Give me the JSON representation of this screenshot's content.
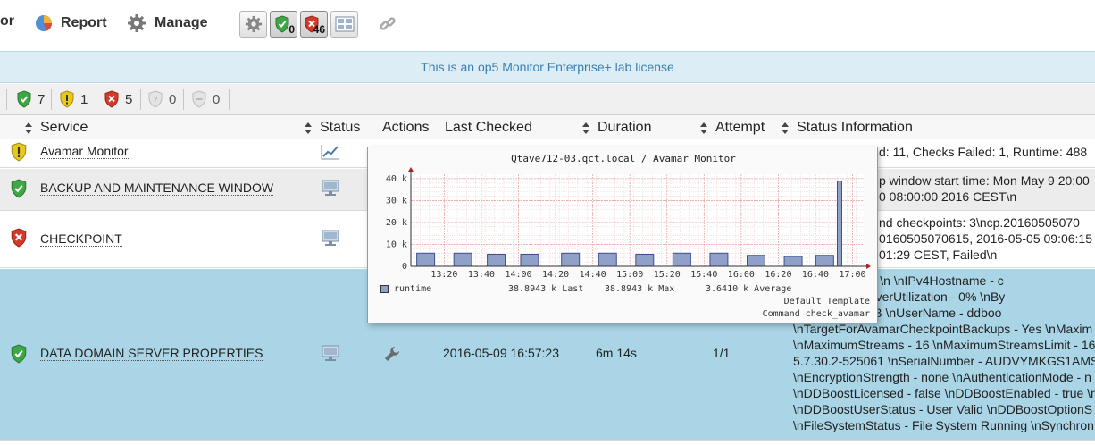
{
  "nav": {
    "partial_label": "or",
    "report_label": "Report",
    "manage_label": "Manage"
  },
  "toolbar": {
    "ok_count": "0",
    "critical_count": "46"
  },
  "banner": {
    "text": "This is an op5 Monitor Enterprise+ lab license"
  },
  "summary": {
    "ok": "7",
    "warning": "1",
    "critical": "5",
    "unknown": "0",
    "pending": "0"
  },
  "columns": {
    "service": "Service",
    "status": "Status",
    "actions": "Actions",
    "last_checked": "Last Checked",
    "duration": "Duration",
    "attempt": "Attempt",
    "status_info": "Status Information"
  },
  "rows": [
    {
      "service": "Avamar Monitor",
      "state": "warning",
      "info": [
        "d: 11, Checks Failed: 1, Runtime: 488"
      ]
    },
    {
      "service": "BACKUP AND MAINTENANCE WINDOW",
      "state": "ok",
      "info": [
        "p window start time: Mon May 9 20:00",
        "0 08:00:00 2016 CEST\\n"
      ]
    },
    {
      "service": "CHECKPOINT",
      "state": "critical",
      "info": [
        "nd checkpoints: 3\\ncp.20160505070",
        "0160505070615, 2016-05-05 09:06:15",
        "01:29 CEST, Failed\\n"
      ]
    },
    {
      "service": "DATA DOMAIN SERVER PROPERTIES",
      "state": "ok",
      "last_checked": "2016-05-09 16:57:23",
      "duration": "6m 14s",
      "attempt": "1/1",
      "info": [
        "ore information \\n \\nIPv4Hostname - c",
        "- 0.0 GiB \\nServerUtilization - 0% \\nBy",
        "nUsed - 0.0 GiB \\nUserName - ddboo",
        "\\nTargetForAvamarCheckpointBackups - Yes \\nMaxim",
        "\\nMaximumStreams - 16 \\nMaximumStreamsLimit - 16",
        "5.7.30.2-525061 \\nSerialNumber - AUDVYMKGS1AMS",
        "\\nEncryptionStrength - none \\nAuthenticationMode - n",
        "\\nDDBoostLicensed - false \\nDDBoostEnabled - true \\n",
        "\\nDDBoostUserStatus - User Valid \\nDDBoostOptionS",
        "\\nFileSystemStatus - File System Running \\nSynchron"
      ]
    }
  ],
  "popup": {
    "title": "Qtave712-03.qct.local / Avamar Monitor",
    "legend_label": "runtime",
    "last": "38.8943 k Last",
    "max": "38.8943 k Max",
    "average": "3.6410 k Average",
    "template": "Default Template",
    "command": "Command check_avamar"
  },
  "chart_data": {
    "type": "bar",
    "title": "Qtave712-03.qct.local / Avamar Monitor",
    "yticks": [
      "0",
      "10 k",
      "20 k",
      "30 k",
      "40 k"
    ],
    "ylim": [
      0,
      42000
    ],
    "xticks": [
      "13:20",
      "13:40",
      "14:00",
      "14:20",
      "14:40",
      "15:00",
      "15:20",
      "15:40",
      "16:00",
      "16:20",
      "16:40",
      "17:00"
    ],
    "series": [
      {
        "name": "runtime",
        "x": [
          "13:10",
          "13:30",
          "13:48",
          "14:06",
          "14:28",
          "14:48",
          "15:08",
          "15:28",
          "15:48",
          "16:08",
          "16:28",
          "16:45",
          "16:53"
        ],
        "values": [
          6000,
          6000,
          5500,
          5500,
          6000,
          6000,
          5500,
          6000,
          6000,
          5000,
          4500,
          5000,
          38894
        ]
      }
    ],
    "grid": true,
    "colors": {
      "bar": "#3d4f8f",
      "grid": "#e8a8a8"
    }
  },
  "colors": {
    "ok": "#3fa646",
    "warning": "#e8c81a",
    "critical": "#d23a2a",
    "banner_text": "#3a7fb0",
    "selected_row": "#a9d5e6"
  }
}
